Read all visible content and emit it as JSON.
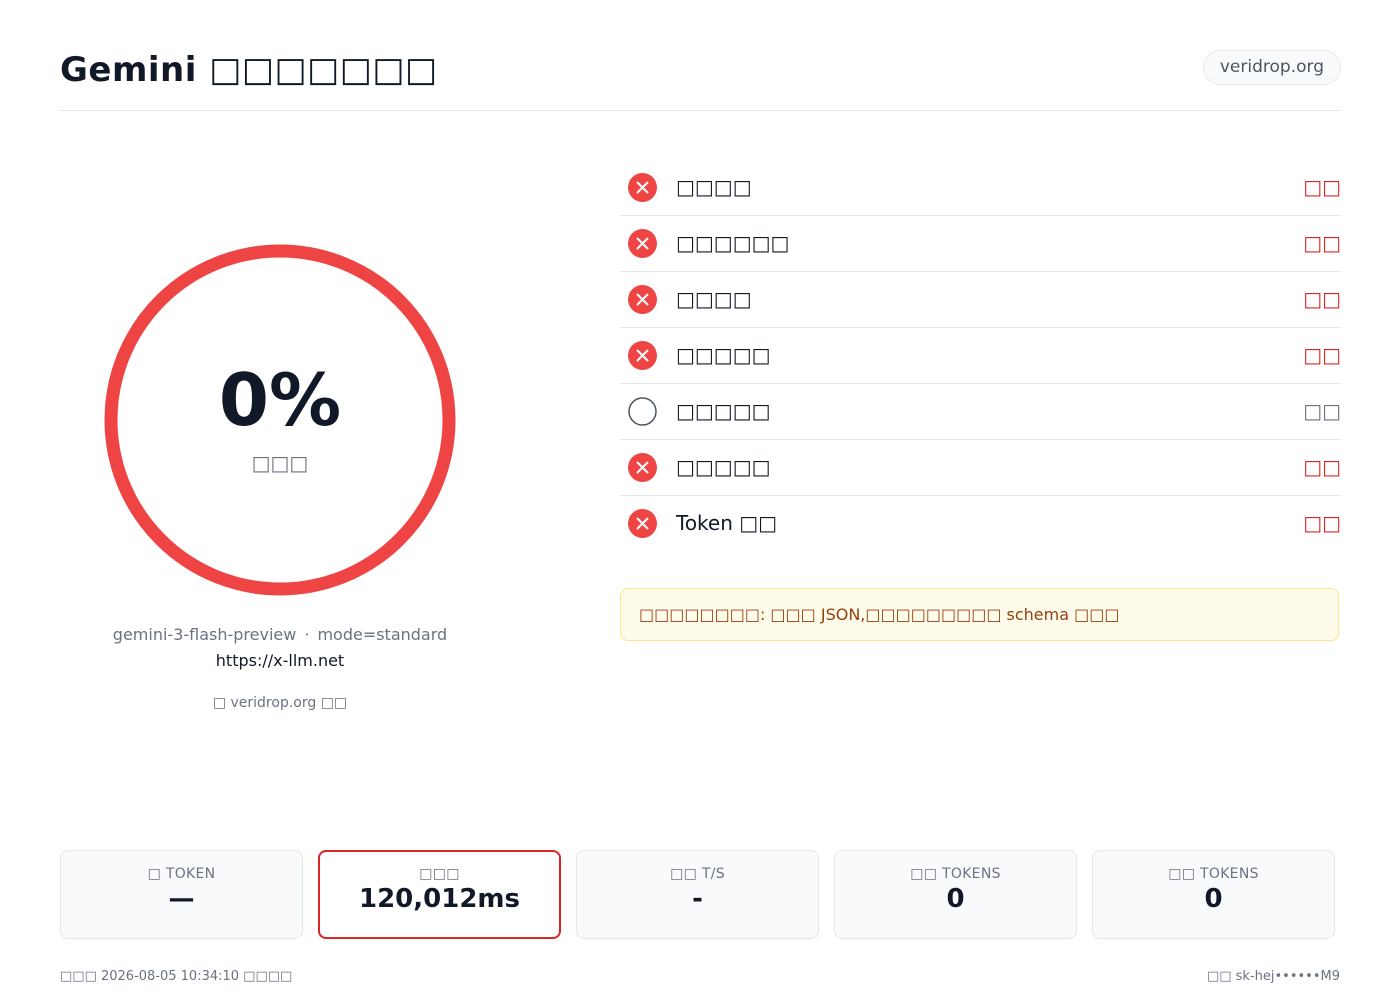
{
  "header": {
    "title": "Gemini □□□□□□□",
    "site_badge": "veridrop.org"
  },
  "gauge": {
    "value_text": "0%",
    "value": 0,
    "label": "□□□",
    "ring_color": "#ef4444"
  },
  "model": {
    "name": "gemini-3-flash-preview",
    "separator": "·",
    "mode": "mode=standard",
    "endpoint": "https://x-llm.net",
    "powered_by": "□ veridrop.org □□"
  },
  "checks": [
    {
      "name": "□□□□",
      "status": "□□",
      "state": "fail",
      "icon": "x-circle-icon"
    },
    {
      "name": "□□□□□□",
      "status": "□□",
      "state": "fail",
      "icon": "x-circle-icon"
    },
    {
      "name": "□□□□",
      "status": "□□",
      "state": "fail",
      "icon": "x-circle-icon"
    },
    {
      "name": "□□□□□",
      "status": "□□",
      "state": "fail",
      "icon": "x-circle-icon"
    },
    {
      "name": "□□□□□",
      "status": "□□",
      "state": "skip",
      "icon": "empty-circle-icon"
    },
    {
      "name": "□□□□□",
      "status": "□□",
      "state": "fail",
      "icon": "x-circle-icon"
    },
    {
      "name": "Token □□",
      "status": "□□",
      "state": "fail",
      "icon": "x-circle-icon"
    }
  ],
  "warning": {
    "text": "□□□□□□□□: □□□ JSON,□□□□□□□□□ schema □□□"
  },
  "stats": [
    {
      "label": "□ TOKEN",
      "value": "—"
    },
    {
      "label": "□□□",
      "value": "120,012ms"
    },
    {
      "label": "□□ T/S",
      "value": "-"
    },
    {
      "label": "□□ TOKENS",
      "value": "0"
    },
    {
      "label": "□□ TOKENS",
      "value": "0"
    }
  ],
  "footer": {
    "left": "□□□ 2026-08-05 10:34:10 □□□□",
    "right": "□□ sk-hej••••••M9"
  },
  "colors": {
    "fail": "#dc2626",
    "fail_icon": "#ef4444",
    "skip": "#6b7280",
    "warning_bg": "#fffbeb",
    "warning_text": "#92400e"
  }
}
